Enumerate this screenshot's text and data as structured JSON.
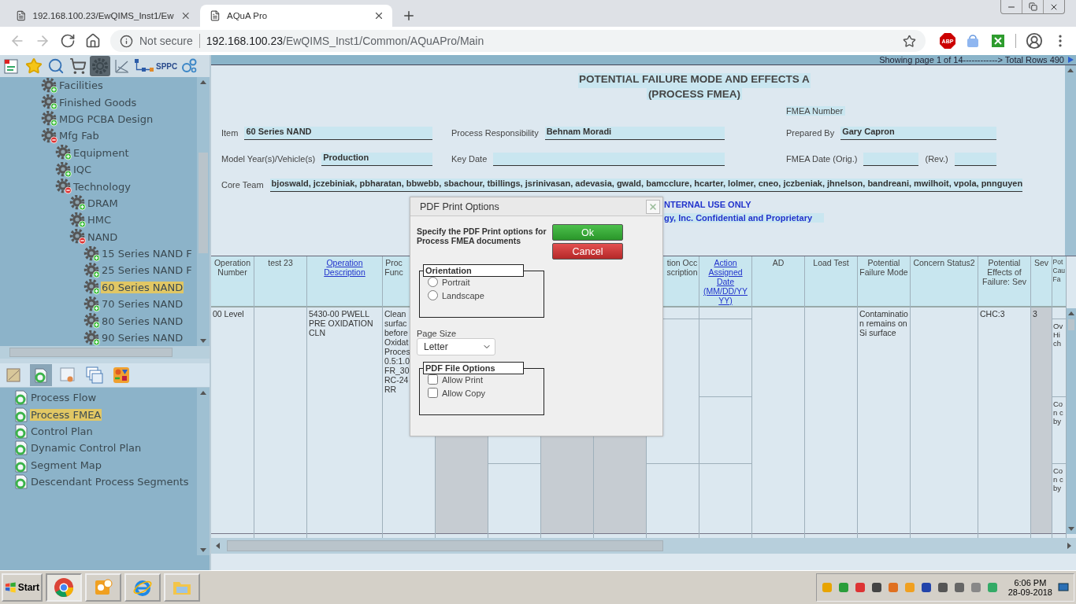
{
  "browser": {
    "tabs": [
      {
        "title": "192.168.100.23/EwQIMS_Inst1/Ew",
        "selected": false
      },
      {
        "title": "AQuA Pro",
        "selected": true
      }
    ],
    "security": "Not secure",
    "url_host": "192.168.100.23",
    "url_path": "/EwQIMS_Inst1/Common/AQuAPro/Main",
    "extension_badge": "ABP"
  },
  "toolbar": {
    "sppc_label": "SPPC"
  },
  "tree": [
    {
      "label": "Facilities",
      "expanded": false,
      "selected": false
    },
    {
      "label": "Finished Goods",
      "expanded": false,
      "selected": false
    },
    {
      "label": "MDG PCBA Design",
      "expanded": false,
      "selected": false
    },
    {
      "label": "Mfg Fab",
      "expanded": true,
      "selected": false,
      "children": [
        {
          "label": "Equipment",
          "expanded": false,
          "selected": false
        },
        {
          "label": "IQC",
          "expanded": false,
          "selected": false
        },
        {
          "label": "Technology",
          "expanded": true,
          "selected": false,
          "children": [
            {
              "label": "DRAM",
              "expanded": false,
              "selected": false
            },
            {
              "label": "HMC",
              "expanded": false,
              "selected": false
            },
            {
              "label": "NAND",
              "expanded": true,
              "selected": false,
              "children": [
                {
                  "label": "15 Series NAND F",
                  "expanded": false,
                  "selected": false
                },
                {
                  "label": "25 Series NAND F",
                  "expanded": false,
                  "selected": false
                },
                {
                  "label": "60 Series NAND",
                  "expanded": false,
                  "selected": true
                },
                {
                  "label": "70 Series NAND",
                  "expanded": false,
                  "selected": false
                },
                {
                  "label": "80 Series NAND",
                  "expanded": false,
                  "selected": false
                },
                {
                  "label": "90 Series NAND",
                  "expanded": false,
                  "selected": false
                }
              ]
            }
          ]
        }
      ]
    }
  ],
  "documents": [
    {
      "label": "Process Flow",
      "selected": false
    },
    {
      "label": "Process FMEA",
      "selected": true
    },
    {
      "label": "Control Plan",
      "selected": false
    },
    {
      "label": "Dynamic Control Plan",
      "selected": false
    },
    {
      "label": "Segment Map",
      "selected": false
    },
    {
      "label": "Descendant Process Segments",
      "selected": false
    }
  ],
  "paging": "Showing page 1 of 14------------> Total Rows 490",
  "form": {
    "title": "POTENTIAL FAILURE MODE AND EFFECTS A",
    "subtitle": "(PROCESS FMEA)",
    "fmea_number_label": "FMEA Number",
    "rows": [
      [
        {
          "kind": "single",
          "label": "Item",
          "value": "60 Series NAND"
        },
        {
          "kind": "single",
          "label": "Process Responsibility",
          "value": "Behnam Moradi"
        },
        {
          "kind": "single",
          "label": "Prepared By",
          "value": "Gary Capron"
        }
      ],
      [
        {
          "kind": "single",
          "label": "Model Year(s)/Vehicle(s)",
          "value": "Production"
        },
        {
          "kind": "single",
          "label": "Key Date"
        },
        {
          "kind": "pair",
          "label": "FMEA Date (Orig.)",
          "second_label": "(Rev.)"
        }
      ]
    ],
    "core_team": {
      "label": "Core Team",
      "value": "bjoswald, jczebiniak, pbharatan, bbwebb, sbachour, tbillings, jsrinivasan, adevasia, gwald, bamcclure, hcarter, lolmer, cneo, jczbeniak, jhnelson, bandreani, mwilhoit, vpola, pnnguyen"
    },
    "notices": [
      "NTERNAL USE ONLY",
      "gy, Inc. Confidential and Proprietary"
    ]
  },
  "table": {
    "columns": [
      {
        "kind": "plain",
        "header": "Operation Number"
      },
      {
        "kind": "plain",
        "header": "test 23"
      },
      {
        "kind": "link",
        "header": "Operation Description"
      },
      {
        "kind": "partial",
        "header": "Proc Func"
      },
      {
        "kind": "covered"
      },
      {
        "kind": "covered"
      },
      {
        "kind": "covered"
      },
      {
        "kind": "covered"
      },
      {
        "kind": "partial",
        "header": "tion Occ scription"
      },
      {
        "kind": "link",
        "header": "Action Assigned Date (MM/DD/YYYY)"
      },
      {
        "kind": "plain",
        "header": "AD"
      },
      {
        "kind": "plain",
        "header": "Load Test"
      },
      {
        "kind": "plain",
        "header": "Potential Failure Mode"
      },
      {
        "kind": "plain",
        "header": "Concern Status2"
      },
      {
        "kind": "plain",
        "header": "Potential Effects of Failure: Sev"
      },
      {
        "kind": "plain",
        "header": "Sev"
      },
      {
        "kind": "partial",
        "header": "Pot Cau Fa"
      }
    ],
    "row": {
      "operation_number": "00 Level",
      "operation_description": "5430-00 PWELL PRE OXIDATION CLN",
      "process_function": "Clean surfac before Oxidat Proces 0.5:1.0 FR_30 RC-24 RR",
      "potential_failure_mode": "Contamination remains on Si surface",
      "effects_of_failure_sev": "CHC:3",
      "sev": "3",
      "column_17": [
        "Ov Hi ch",
        "Co n c by",
        "Co n c by"
      ]
    }
  },
  "dialog": {
    "title": "PDF Print Options",
    "instructions": "Specify the PDF Print options for Process FMEA documents",
    "ok": "Ok",
    "cancel": "Cancel",
    "orientation": {
      "legend": "Orientation",
      "options": [
        {
          "label": "Portrait",
          "selected": false
        },
        {
          "label": "Landscape",
          "selected": false
        }
      ]
    },
    "page_size": {
      "label": "Page Size",
      "value": "Letter"
    },
    "file_options": {
      "legend": "PDF File Options",
      "options": [
        {
          "label": "Allow Print",
          "checked": false
        },
        {
          "label": "Allow Copy",
          "checked": false
        }
      ]
    }
  },
  "taskbar": {
    "start": "Start",
    "time": "6:06 PM",
    "date": "28-09-2018"
  }
}
